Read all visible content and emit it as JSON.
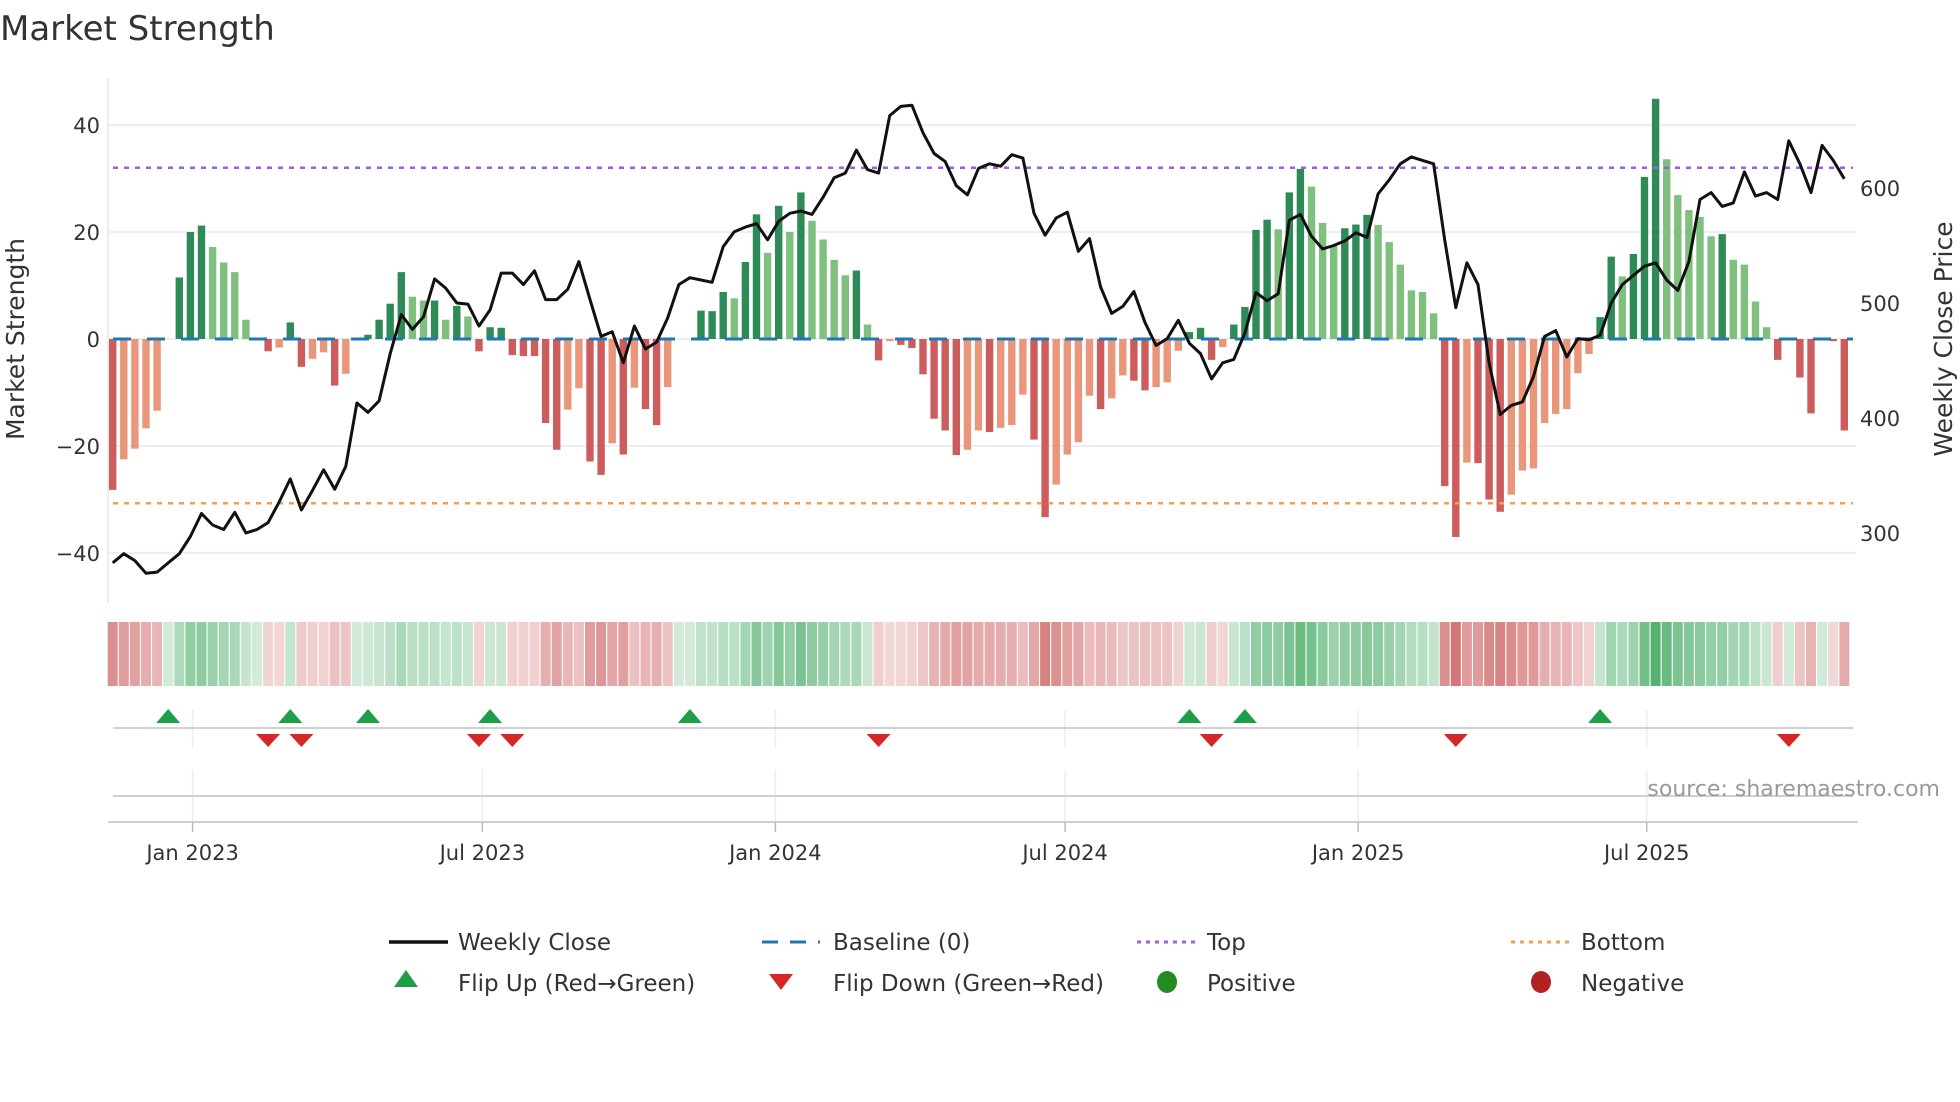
{
  "title": "Market Strength",
  "source": "source: sharemaestro.com",
  "chart_data": {
    "type": "bar",
    "title": "Market Strength",
    "ylabel": "Market Strength",
    "y2label": "Weekly Close Price",
    "ylim": [
      -48,
      48
    ],
    "y2lim": [
      263,
      683
    ],
    "yticks": [
      {
        "v": 40,
        "label": "40"
      },
      {
        "v": 20,
        "label": "20"
      },
      {
        "v": 0,
        "label": "0"
      },
      {
        "v": -20,
        "label": "−20"
      },
      {
        "v": -40,
        "label": "−40"
      }
    ],
    "y2ticks": [
      {
        "v": 600,
        "label": "600"
      },
      {
        "v": 500,
        "label": "500"
      },
      {
        "v": 400,
        "label": "400"
      },
      {
        "v": 300,
        "label": "300"
      }
    ],
    "xticks": [
      {
        "week": 7.2,
        "label": "Jan 2023"
      },
      {
        "week": 33.3,
        "label": "Jul 2023"
      },
      {
        "week": 59.7,
        "label": "Jan 2024"
      },
      {
        "week": 85.8,
        "label": "Jul 2024"
      },
      {
        "week": 112.2,
        "label": "Jan 2025"
      },
      {
        "week": 138.2,
        "label": "Jul 2025"
      }
    ],
    "top_level": 32,
    "bottom_level": -30.7,
    "baseline": 0,
    "strength": [
      -28.2,
      -22.5,
      -20.5,
      -16.7,
      -13.4,
      0,
      11.5,
      20,
      21.2,
      17.2,
      14.3,
      12.5,
      3.6,
      0,
      -2.3,
      -1.6,
      3.1,
      -5.2,
      -3.7,
      -2.5,
      -8.7,
      -6.5,
      0,
      0.8,
      3.6,
      6.6,
      12.5,
      7.9,
      7.2,
      7.2,
      3.6,
      6.2,
      4.2,
      -2.3,
      2.2,
      2.1,
      -3,
      -3.2,
      -3.2,
      -15.7,
      -20.7,
      -13.2,
      -9.2,
      -22.9,
      -25.4,
      -19.5,
      -21.6,
      -9.1,
      -13.1,
      -16.1,
      -9,
      0,
      0,
      5.3,
      5.2,
      8.8,
      7.6,
      14.4,
      23.3,
      16.1,
      24.9,
      20,
      27.4,
      22.1,
      18.6,
      14.8,
      11.9,
      12.8,
      2.7,
      -4,
      -0.4,
      -1.1,
      -1.7,
      -6.6,
      -14.9,
      -17.1,
      -21.7,
      -20.7,
      -17.1,
      -17.4,
      -16.6,
      -16.1,
      -10.4,
      -18.8,
      -33.3,
      -27.2,
      -21.6,
      -19.3,
      -10.6,
      -13.1,
      -11.1,
      -6.8,
      -7.8,
      -9.6,
      -9,
      -8.1,
      -2.2,
      1.3,
      2.1,
      -3.9,
      -1.5,
      2.7,
      6,
      20.4,
      22.3,
      20.5,
      27.4,
      31.8,
      28.5,
      21.7,
      17.4,
      20.7,
      21.4,
      23.2,
      21.3,
      18.1,
      13.9,
      9.1,
      8.8,
      4.8,
      -27.5,
      -37,
      -23.1,
      -23.2,
      -30,
      -32.3,
      -29.1,
      -24.6,
      -24.2,
      -15.7,
      -14,
      -13.1,
      -6.4,
      -2.8,
      4.1,
      15.4,
      11.7,
      15.9,
      30.3,
      44.9,
      33.6,
      26.9,
      24.1,
      22.8,
      19.2,
      19.6,
      14.8,
      13.9,
      7,
      2.2,
      -3.9,
      0,
      -7.2,
      -13.9,
      0,
      -0.4,
      -17.1
    ],
    "close": [
      274,
      282,
      276,
      265,
      266,
      274,
      282,
      297,
      317,
      307,
      303,
      318,
      300,
      303,
      309,
      327,
      347,
      320,
      337,
      355,
      338,
      358,
      413,
      405,
      415,
      456,
      490,
      477,
      488,
      521,
      513,
      500,
      499,
      480,
      494,
      526,
      526,
      516,
      528,
      503,
      503,
      512,
      536,
      503,
      471,
      475,
      448,
      480,
      460,
      466,
      487,
      516,
      522,
      520,
      518,
      549,
      562,
      566,
      569,
      555,
      571,
      578,
      580,
      577,
      592,
      609,
      613,
      633,
      616,
      613,
      663,
      671,
      672,
      648,
      630,
      623,
      602,
      594,
      617,
      621,
      619,
      629,
      626,
      578,
      559,
      574,
      579,
      545,
      556,
      514,
      491,
      497,
      510,
      483,
      463,
      469,
      485,
      465,
      456,
      434,
      448,
      451,
      474,
      509,
      502,
      508,
      572,
      577,
      558,
      547,
      550,
      554,
      561,
      557,
      595,
      607,
      621,
      627,
      624,
      621,
      555,
      496,
      535,
      516,
      448,
      403,
      411,
      414,
      436,
      471,
      476,
      453,
      469,
      468,
      472,
      500,
      516,
      524,
      532,
      535,
      520,
      511,
      536,
      590,
      596,
      584,
      587,
      614,
      593,
      596,
      590,
      641,
      621,
      596,
      637,
      624,
      608
    ],
    "flip_up_weeks": [
      5,
      16,
      23,
      34,
      52,
      97,
      102,
      134
    ],
    "flip_down_weeks": [
      14,
      17,
      33,
      36,
      69,
      99,
      121,
      151
    ],
    "legend": {
      "weekly_close": "Weekly Close",
      "baseline": "Baseline (0)",
      "top": "Top",
      "bottom": "Bottom",
      "flip_up": "Flip Up (Red→Green)",
      "flip_down": "Flip Down (Green→Red)",
      "positive": "Positive",
      "negative": "Negative"
    },
    "legend_placement": "bottom",
    "grid": true
  },
  "colors": {
    "pos_dark": "#2e8b57",
    "pos_light": "#80c07e",
    "neg_dark": "#cd5c5c",
    "neg_light": "#e9967a",
    "top": "#9d5fe0",
    "bottom": "#f0a050",
    "baseline": "#1f77b4",
    "flip_up": "#1e9e48",
    "flip_down": "#d62728",
    "positive": "#228b22",
    "negative": "#b22222"
  }
}
